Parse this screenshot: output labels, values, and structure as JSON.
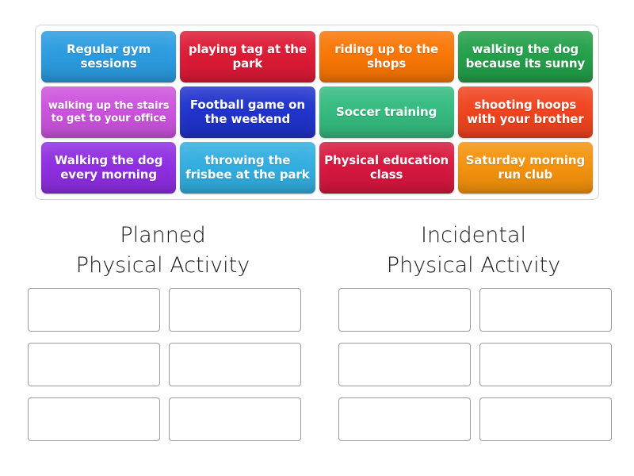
{
  "activity": {
    "tiles": [
      {
        "text": "Regular gym\nsessions",
        "color": "#2b9ce0",
        "size": "normal"
      },
      {
        "text": "playing tag\nat the park",
        "color": "#dd1a35",
        "size": "normal"
      },
      {
        "text": "riding up to\nthe shops",
        "color": "#f97605",
        "size": "normal"
      },
      {
        "text": "walking the dog\nbecause its sunny",
        "color": "#23a04a",
        "size": "normal"
      },
      {
        "text": "walking up the\nstairs to get\nto your office",
        "color": "#cc53dd",
        "size": "small"
      },
      {
        "text": "Football game\non the weekend",
        "color": "#2033cc",
        "size": "normal"
      },
      {
        "text": "Soccer training",
        "color": "#35bb80",
        "size": "normal"
      },
      {
        "text": "shooting hoops\nwith your brother",
        "color": "#f0441f",
        "size": "normal"
      },
      {
        "text": "Walking the dog\nevery morning",
        "color": "#8f2ee2",
        "size": "normal"
      },
      {
        "text": "throwing the\nfrisbee at the park",
        "color": "#32aee0",
        "size": "normal"
      },
      {
        "text": "Physical\neducation class",
        "color": "#d8173e",
        "size": "normal"
      },
      {
        "text": "Saturday\nmorning run club",
        "color": "#f4930d",
        "size": "normal"
      }
    ]
  },
  "categories": [
    {
      "name": "planned",
      "title": "Planned\nPhysical Activity",
      "slot_count": 6
    },
    {
      "name": "incidental",
      "title": "Incidental\nPhysical Activity",
      "slot_count": 6
    }
  ]
}
